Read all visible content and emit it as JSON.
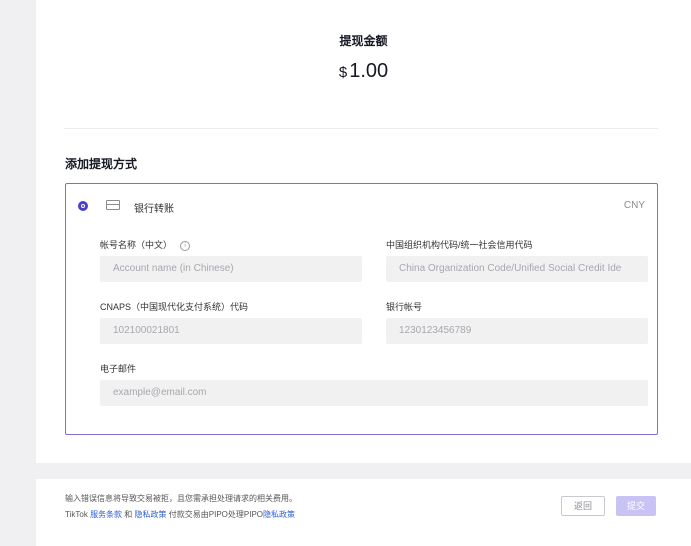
{
  "amount": {
    "label": "提现金额",
    "currency_symbol": "$",
    "value": "1.00"
  },
  "section_title": "添加提现方式",
  "method": {
    "name": "银行转账",
    "currency": "CNY",
    "icon": "bank-card-icon"
  },
  "fields": {
    "account_name": {
      "label": "帐号名称（中文）",
      "placeholder": "Account name (in Chinese)"
    },
    "org_code": {
      "label": "中国组织机构代码/统一社会信用代码",
      "placeholder": "China Organization Code/Unified Social Credit Ide"
    },
    "cnaps": {
      "label": "CNAPS（中国现代化支付系统）代码",
      "placeholder": "102100021801"
    },
    "bank_account": {
      "label": "银行帐号",
      "placeholder": "1230123456789"
    },
    "email": {
      "label": "电子邮件",
      "placeholder": "example@email.com"
    }
  },
  "footer": {
    "line1": "输入错误信息将导致交易被拒，且您需承担处理请求的相关费用。",
    "line2_prefix": "TikTok",
    "terms_link": "服务条款",
    "and": "和",
    "privacy_link": "隐私政策",
    "line2_mid": "付款交易由PIPO处理PIPO",
    "privacy_link2": "隐私政策",
    "back_button": "返回",
    "submit_button": "提交"
  },
  "colors": {
    "accent": "#4a3fd1",
    "link": "#2a5ed6",
    "submit_disabled": "#c9c3f5"
  }
}
